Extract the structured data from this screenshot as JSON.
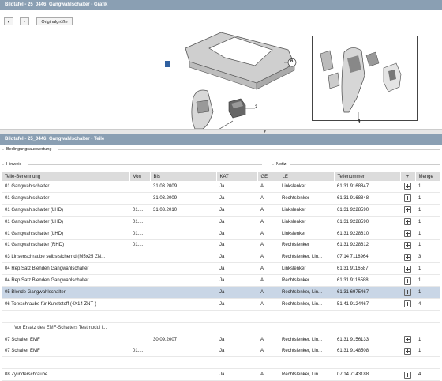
{
  "graphic_title": "Bildtafel - 25_0446: Gangwahlschalter - Grafik",
  "toolbar": {
    "menu_symbol": "▾",
    "minus_symbol": "-",
    "original_size": "Originalgröße"
  },
  "callouts": {
    "c1": "1",
    "c2": "2",
    "c4": "4",
    "c6": "6"
  },
  "parts_title": "Bildtafel - 25_0446: Gangwahlschalter - Teile",
  "sections": {
    "bedingung": "Bedingungsauswertung",
    "hinweis": "Hinweis",
    "notiz": "Notiz"
  },
  "columns": [
    "Teile-Benennung",
    "Von",
    "Bis",
    "KAT",
    "GE",
    "LE",
    "Teilenummer",
    "+",
    "Menge"
  ],
  "rows": [
    {
      "name": "01 Gangwahlschalter",
      "von": "",
      "bis": "31.03.2009",
      "kat": "Ja",
      "ge": "A",
      "le": "Linkslenker",
      "nr": "61 31 9168847",
      "cart": true,
      "menge": "1"
    },
    {
      "name": "01 Gangwahlschalter",
      "von": "",
      "bis": "31.03.2009",
      "kat": "Ja",
      "ge": "A",
      "le": "Rechtslenker",
      "nr": "61 31 9168848",
      "cart": true,
      "menge": "1"
    },
    {
      "name": "01 Gangwahlschalter (LHD)",
      "von": "01....",
      "bis": "31.03.2010",
      "kat": "Ja",
      "ge": "A",
      "le": "Linkslenker",
      "nr": "61 31 9228590",
      "cart": true,
      "menge": "1"
    },
    {
      "name": "01 Gangwahlschalter (LHD)",
      "von": "01....",
      "bis": "",
      "kat": "Ja",
      "ge": "A",
      "le": "Linkslenker",
      "nr": "61 31 9228590",
      "cart": true,
      "menge": "1"
    },
    {
      "name": "01 Gangwahlschalter (LHD)",
      "von": "01....",
      "bis": "",
      "kat": "Ja",
      "ge": "A",
      "le": "Linkslenker",
      "nr": "61 31 9228610",
      "cart": true,
      "menge": "1"
    },
    {
      "name": "01 Gangwahlschalter (RHD)",
      "von": "01....",
      "bis": "",
      "kat": "Ja",
      "ge": "A",
      "le": "Rechtslenker",
      "nr": "61 31 9228612",
      "cart": true,
      "menge": "1"
    },
    {
      "name": "03 Linsenschraube selbstsichernd (M5x25 ZN...",
      "von": "",
      "bis": "",
      "kat": "Ja",
      "ge": "A",
      "le": "Rechtslenker, Lin...",
      "nr": "07 14 7118964",
      "cart": true,
      "menge": "3"
    },
    {
      "name": "04 Rep.Satz Blenden Gangwahlschalter",
      "von": "",
      "bis": "",
      "kat": "Ja",
      "ge": "A",
      "le": "Linkslenker",
      "nr": "61 31 9116587",
      "cart": true,
      "menge": "1"
    },
    {
      "name": "04 Rep.Satz Blenden Gangwahlschalter",
      "von": "",
      "bis": "",
      "kat": "Ja",
      "ge": "A",
      "le": "Rechtslenker",
      "nr": "61 31 9116588",
      "cart": true,
      "menge": "1"
    },
    {
      "name": "05 Blende Gangwahlschalter",
      "von": "",
      "bis": "",
      "kat": "Ja",
      "ge": "A",
      "le": "Rechtslenker, Lin...",
      "nr": "61 31 6975467",
      "cart": true,
      "menge": "1",
      "selected": true
    },
    {
      "name": "06 Torxschraube für Kunststoff (4X14 ZNT )",
      "von": "",
      "bis": "",
      "kat": "Ja",
      "ge": "A",
      "le": "Rechtslenker, Lin...",
      "nr": "51 41 9124467",
      "cart": true,
      "menge": "4"
    },
    {
      "name": "",
      "von": "",
      "bis": "",
      "kat": "",
      "ge": "",
      "le": "",
      "nr": "",
      "cart": false,
      "menge": ""
    },
    {
      "name": "Vor Ersatz des EMF-Schalters Testmodul i...",
      "von": "",
      "bis": "",
      "kat": "",
      "ge": "",
      "le": "",
      "nr": "",
      "cart": false,
      "menge": "",
      "note": true
    },
    {
      "name": "07 Schalter EMF",
      "von": "",
      "bis": "30.09.2007",
      "kat": "Ja",
      "ge": "A",
      "le": "Rechtslenker, Lin...",
      "nr": "61 31 9156133",
      "cart": true,
      "menge": "1"
    },
    {
      "name": "07 Schalter EMF",
      "von": "01....",
      "bis": "",
      "kat": "Ja",
      "ge": "A",
      "le": "Rechtslenker, Lin...",
      "nr": "61 31 9148508",
      "cart": true,
      "menge": "1"
    },
    {
      "name": "",
      "von": "",
      "bis": "",
      "kat": "",
      "ge": "",
      "le": "",
      "nr": "",
      "cart": false,
      "menge": ""
    },
    {
      "name": "08 Zylinderschraube",
      "von": "",
      "bis": "",
      "kat": "Ja",
      "ge": "A",
      "le": "Rechtslenker, Lin...",
      "nr": "07 14 7143188",
      "cart": true,
      "menge": "4"
    }
  ]
}
